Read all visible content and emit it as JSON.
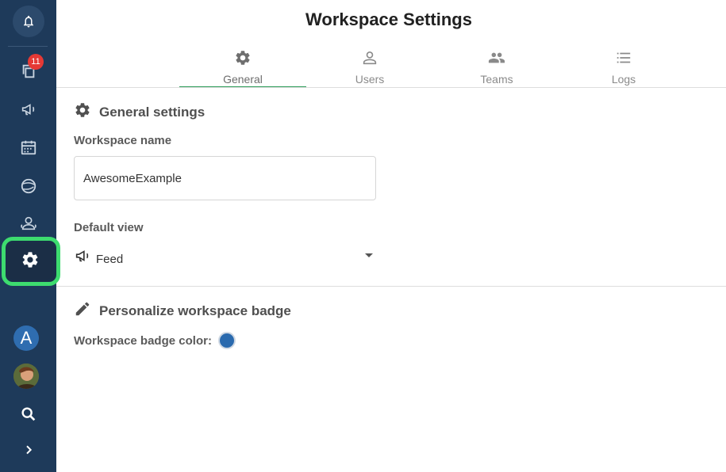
{
  "sidebar": {
    "notification_count": "11",
    "items": [
      {
        "icon": "bell-icon"
      },
      {
        "icon": "copy-pages-icon"
      },
      {
        "icon": "megaphone-icon"
      },
      {
        "icon": "calendar-icon"
      },
      {
        "icon": "globe-icon"
      },
      {
        "icon": "people-icon"
      },
      {
        "icon": "gear-icon"
      }
    ],
    "workspace_initial": "A",
    "bottom": [
      {
        "icon": "search-icon"
      },
      {
        "icon": "chevron-right-icon"
      }
    ]
  },
  "header": {
    "title": "Workspace Settings"
  },
  "tabs": [
    {
      "label": "General",
      "icon": "gear-icon",
      "active": true
    },
    {
      "label": "Users",
      "icon": "person-icon",
      "active": false
    },
    {
      "label": "Teams",
      "icon": "group-icon",
      "active": false
    },
    {
      "label": "Logs",
      "icon": "list-icon",
      "active": false
    }
  ],
  "general": {
    "section_title": "General settings",
    "workspace_name_label": "Workspace name",
    "workspace_name_value": "AwesomeExample",
    "default_view_label": "Default view",
    "default_view_value": "Feed"
  },
  "badge": {
    "section_title": "Personalize workspace badge",
    "color_label": "Workspace badge color:",
    "color": "#2a6aae"
  },
  "colors": {
    "sidebar": "#1e3a5a",
    "accent": "#2e9e5a",
    "highlight": "#3ddc6f",
    "notification": "#e53935"
  }
}
